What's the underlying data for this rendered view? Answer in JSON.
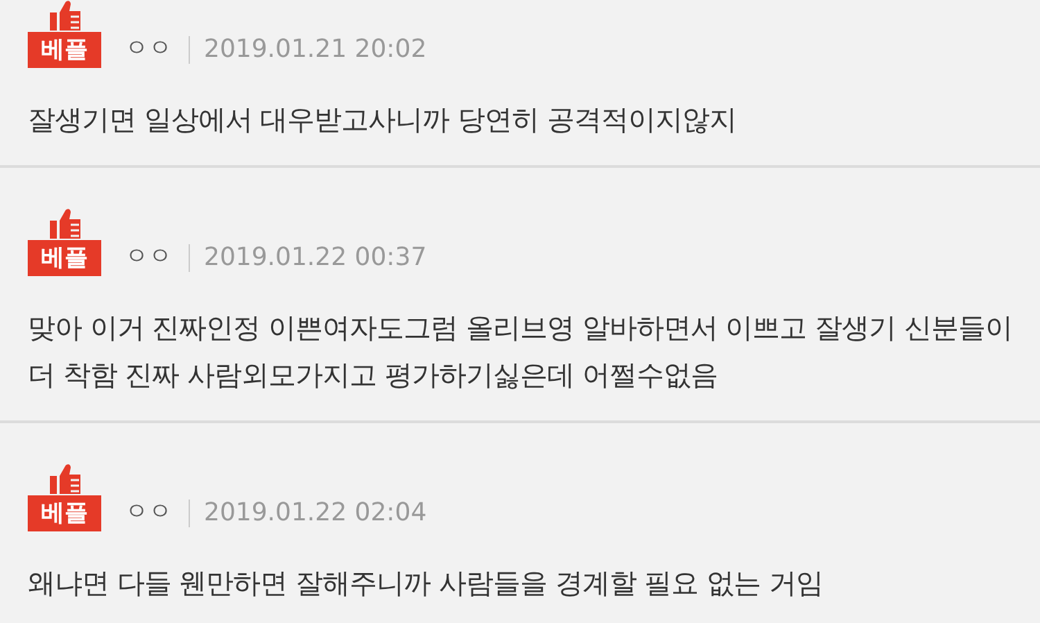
{
  "comments": [
    {
      "badge": "베플",
      "nickname": "ㅇㅇ",
      "date": "2019.01.21 20:02",
      "text": "잘생기면 일상에서 대우받고사니까 당연히 공격적이지않지"
    },
    {
      "badge": "베플",
      "nickname": "ㅇㅇ",
      "date": "2019.01.22 00:37",
      "text": "맞아 이거 진짜인정 이쁜여자도그럼 올리브영 알바하면서 이쁘고 잘생기 신분들이 더 착함 진짜 사람외모가지고 평가하기싫은데 어쩔수없음"
    },
    {
      "badge": "베플",
      "nickname": "ㅇㅇ",
      "date": "2019.01.22 02:04",
      "text": "왜냐면 다들 웬만하면 잘해주니까 사람들을 경계할 필요 없는 거임"
    }
  ]
}
